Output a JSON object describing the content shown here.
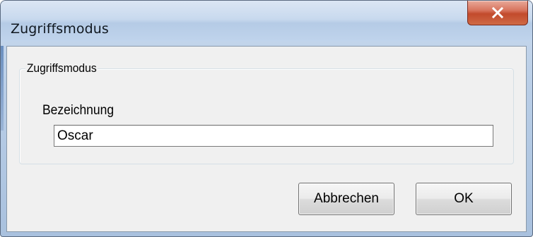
{
  "window": {
    "title": "Zugriffsmodus"
  },
  "titlebar": {
    "close_icon": "close-x-icon"
  },
  "group": {
    "legend": "Zugriffsmodus"
  },
  "field": {
    "label": "Bezeichnung",
    "value": "Oscar"
  },
  "buttons": {
    "cancel_label": "Abbrechen",
    "ok_label": "OK"
  },
  "colors": {
    "close_button": "#c24a2c",
    "title_bar": "#c8d9ee",
    "client_background": "#f0f0f0"
  }
}
